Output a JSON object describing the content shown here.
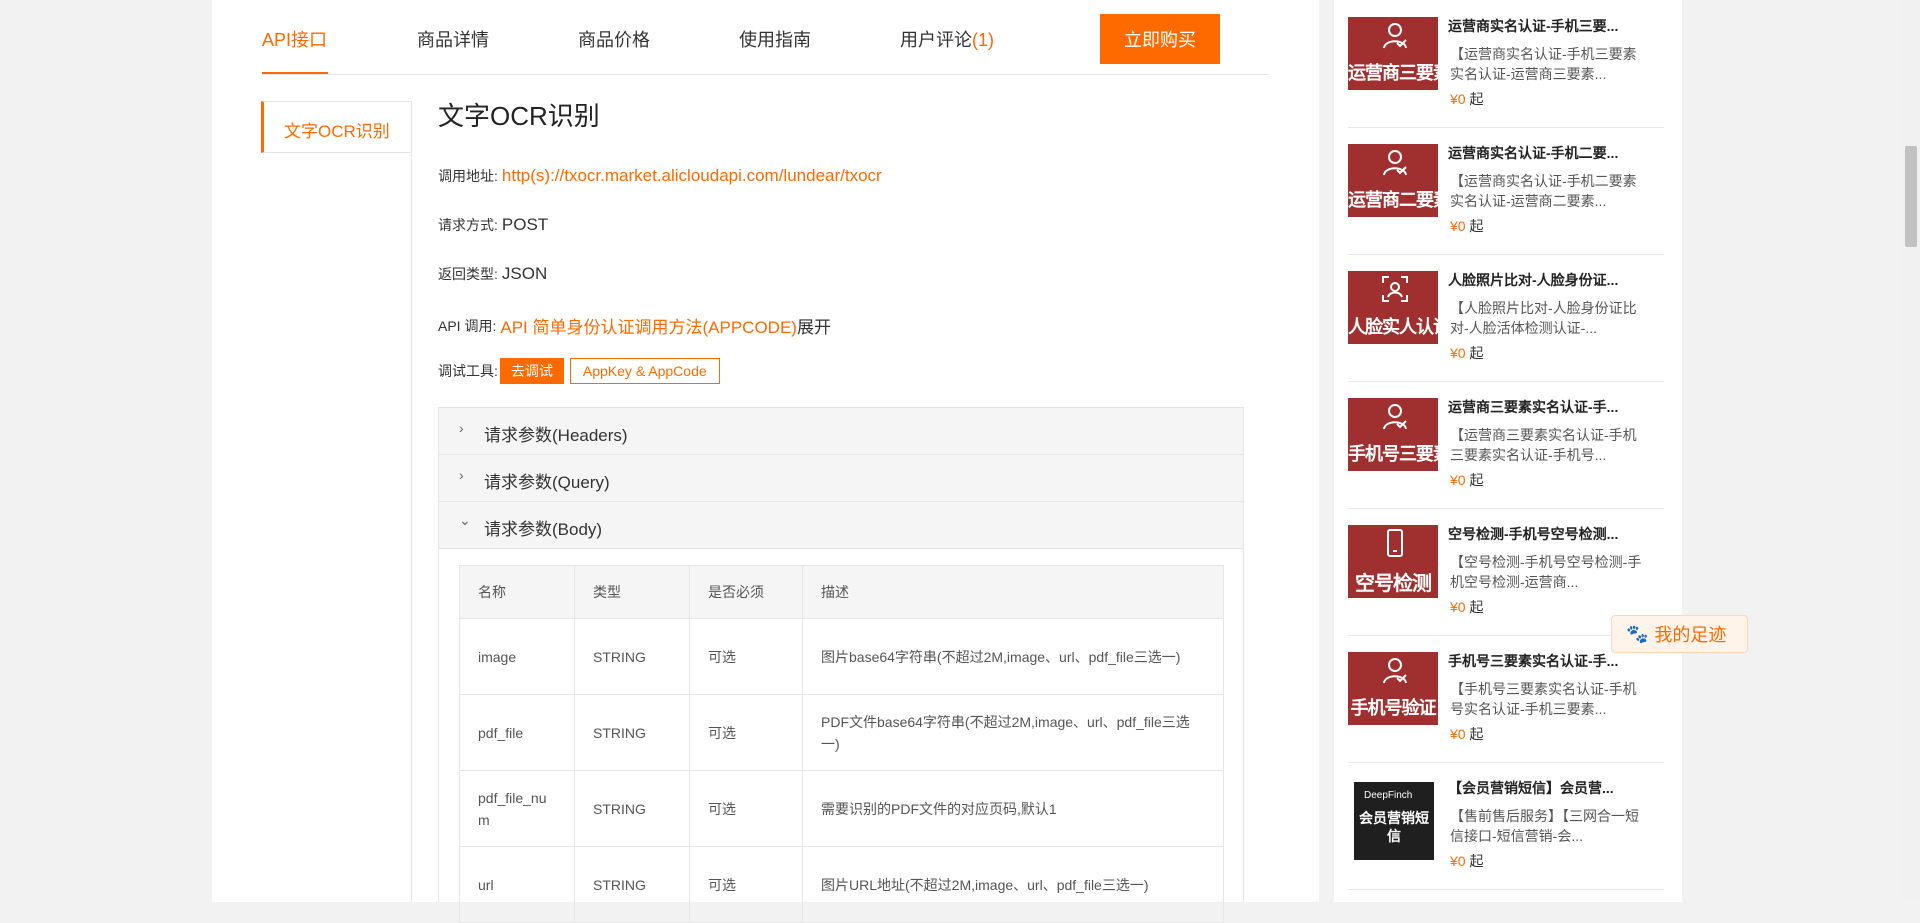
{
  "nav": {
    "tabs": [
      {
        "label": "API接口"
      },
      {
        "label": "商品详情"
      },
      {
        "label": "商品价格"
      },
      {
        "label": "使用指南"
      },
      {
        "label": "用户评论",
        "count": "(1)"
      }
    ],
    "buy_label": "立即购买"
  },
  "subnav": {
    "items": [
      "文字OCR识别"
    ]
  },
  "api": {
    "title": "文字OCR识别",
    "address_label": "调用地址:",
    "address": "http(s)://txocr.market.alicloudapi.com/lundear/txocr",
    "method_label": "请求方式:",
    "method": "POST",
    "return_label": "返回类型:",
    "return_type": "JSON",
    "call_label": "API 调用:",
    "call_link": "API 简单身份认证调用方法(APPCODE)",
    "call_expand": "展开",
    "debug_label": "调试工具:",
    "debug_btn": "去调试",
    "appkey_btn": "AppKey & AppCode"
  },
  "accordion": {
    "sections": [
      {
        "label": "请求参数(Headers)",
        "chevron": "›",
        "expanded": false
      },
      {
        "label": "请求参数(Query)",
        "chevron": "›",
        "expanded": false
      },
      {
        "label": "请求参数(Body)",
        "chevron": "⌄",
        "expanded": true
      }
    ]
  },
  "params": {
    "headers": [
      "名称",
      "类型",
      "是否必须",
      "描述"
    ],
    "rows": [
      [
        "image",
        "STRING",
        "可选",
        "图片base64字符串(不超过2M,image、url、pdf_file三选一)"
      ],
      [
        "pdf_file",
        "STRING",
        "可选",
        "PDF文件base64字符串(不超过2M,image、url、pdf_file三选一)"
      ],
      [
        "pdf_file_num",
        "STRING",
        "可选",
        "需要识别的PDF文件的对应页码,默认1"
      ],
      [
        "url",
        "STRING",
        "可选",
        "图片URL地址(不超过2M,image、url、pdf_file三选一)"
      ]
    ]
  },
  "sidebar": {
    "products": [
      {
        "img_text": "运营商三要素",
        "title": "运营商实名认证-手机三要...",
        "desc": "【运营商实名认证-手机三要素实名认证-运营商三要素...",
        "price": "¥0",
        "unit": "起"
      },
      {
        "img_text": "运营商二要素",
        "title": "运营商实名认证-手机二要...",
        "desc": "【运营商实名认证-手机二要素实名认证-运营商二要素...",
        "price": "¥0",
        "unit": "起"
      },
      {
        "img_text": "人脸实人认证",
        "title": "人脸照片比对-人脸身份证...",
        "desc": "【人脸照片比对-人脸身份证比对-人脸活体检测认证-...",
        "price": "¥0",
        "unit": "起"
      },
      {
        "img_text": "手机号三要素",
        "title": "运营商三要素实名认证-手...",
        "desc": "【运营商三要素实名认证-手机三要素实名认证-手机号...",
        "price": "¥0",
        "unit": "起"
      },
      {
        "img_text": "空号检测",
        "title": "空号检测-手机号空号检测...",
        "desc": "【空号检测-手机号空号检测-手机空号检测-运营商...",
        "price": "¥0",
        "unit": "起"
      },
      {
        "img_text": "手机号验证",
        "title": "手机号三要素实名认证-手...",
        "desc": "【手机号三要素实名认证-手机号实名认证-手机三要素...",
        "price": "¥0",
        "unit": "起"
      },
      {
        "img_text": "会员营销短信",
        "brand": "DeepFinch",
        "title": "【会员营销短信】会员营...",
        "desc": "【售前售后服务】【三网合一短信接口-短信营销-会...",
        "price": "¥0",
        "unit": "起"
      }
    ]
  },
  "footprint": {
    "label": "我的足迹"
  },
  "colors": {
    "accent": "#ff6a00",
    "product_bg": "#a03030"
  }
}
